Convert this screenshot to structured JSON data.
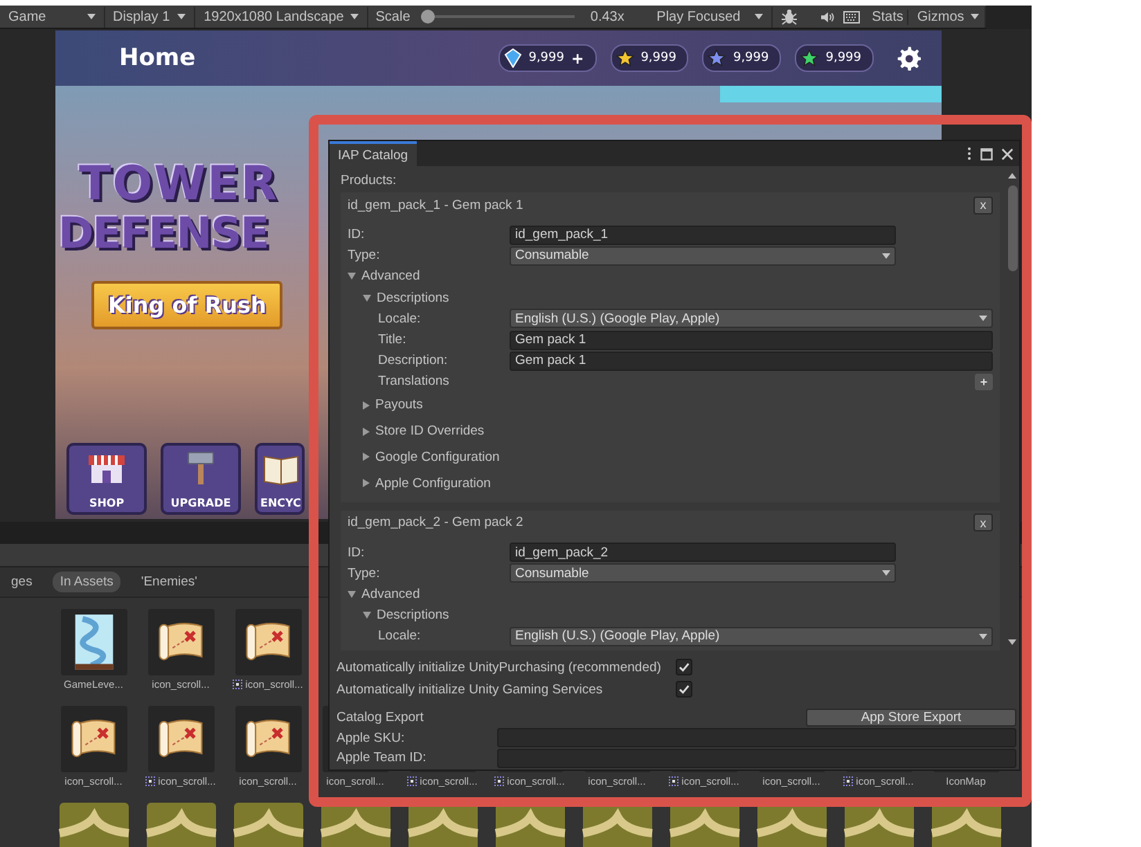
{
  "toolbar": {
    "view": "Game",
    "display": "Display 1",
    "resolution": "1920x1080 Landscape",
    "scale": {
      "label": "Scale",
      "level": 0,
      "reading": "0.43x"
    },
    "play_mode": "Play Focused",
    "stats": "Stats",
    "gizmos": "Gizmos"
  },
  "game_view": {
    "header_title": "Home",
    "currencies": [
      {
        "kind": "gem",
        "amount": "9,999",
        "add": "+"
      },
      {
        "kind": "star",
        "color": "#f2c531",
        "amount": "9,999"
      },
      {
        "kind": "star",
        "color": "#7d8ef0",
        "amount": "9,999"
      },
      {
        "kind": "star",
        "color": "#3fd16a",
        "amount": "9,999"
      }
    ],
    "title_lines": [
      "TOWER",
      "DEFENSE"
    ],
    "banner": "King of Rush",
    "menu_buttons": [
      {
        "kind": "shop",
        "label": "SHOP"
      },
      {
        "kind": "upgrade",
        "label": "UPGRADE"
      },
      {
        "kind": "book",
        "label": "ENCYC"
      }
    ]
  },
  "project": {
    "breadcrumbs": [
      {
        "label": "ges",
        "selected": false
      },
      {
        "label": "In Assets",
        "selected": true
      },
      {
        "label": "'Enemies'",
        "selected": false
      }
    ],
    "rows": [
      [
        {
          "kind": "level-map",
          "label": "GameLeve...",
          "sprite_sheet": false
        },
        {
          "kind": "scroll",
          "label": "icon_scroll...",
          "sprite_sheet": false
        },
        {
          "kind": "scroll",
          "label": "icon_scroll...",
          "sprite_sheet": true
        }
      ],
      [
        {
          "kind": "scroll",
          "label": "icon_scroll...",
          "sprite_sheet": false
        },
        {
          "kind": "scroll",
          "label": "icon_scroll...",
          "sprite_sheet": true
        },
        {
          "kind": "scroll",
          "label": "icon_scroll...",
          "sprite_sheet": false
        },
        {
          "kind": "scroll",
          "label": "icon_scroll...",
          "sprite_sheet": false
        },
        {
          "kind": "scroll",
          "label": "icon_scroll...",
          "sprite_sheet": true
        },
        {
          "kind": "scroll",
          "label": "icon_scroll...",
          "sprite_sheet": true
        },
        {
          "kind": "scroll",
          "label": "icon_scroll...",
          "sprite_sheet": false
        },
        {
          "kind": "scroll",
          "label": "icon_scroll...",
          "sprite_sheet": true
        },
        {
          "kind": "scroll",
          "label": "icon_scroll...",
          "sprite_sheet": false
        },
        {
          "kind": "scroll",
          "label": "icon_scroll...",
          "sprite_sheet": true
        },
        {
          "kind": "scroll",
          "label": "IconMap",
          "sprite_sheet": false
        }
      ],
      [
        {
          "kind": "terrain"
        },
        {
          "kind": "terrain"
        },
        {
          "kind": "terrain"
        },
        {
          "kind": "terrain"
        },
        {
          "kind": "terrain"
        },
        {
          "kind": "terrain"
        },
        {
          "kind": "terrain"
        },
        {
          "kind": "terrain"
        },
        {
          "kind": "terrain"
        },
        {
          "kind": "terrain"
        },
        {
          "kind": "terrain"
        }
      ]
    ]
  },
  "iap_catalog": {
    "tab": "IAP Catalog",
    "products_label": "Products:",
    "products": [
      {
        "header": "id_gem_pack_1 - Gem pack 1",
        "remove": "x",
        "rows": [
          {
            "kind": "text-field",
            "label": "ID:",
            "value": "id_gem_pack_1"
          },
          {
            "kind": "dropdown",
            "label": "Type:",
            "value": "Consumable"
          },
          {
            "kind": "foldout",
            "label": "Advanced",
            "expanded": true,
            "children": [
              {
                "kind": "foldout",
                "label": "Descriptions",
                "expanded": true,
                "children": [
                  {
                    "kind": "dropdown",
                    "label": "Locale:",
                    "value": "English (U.S.) (Google Play, Apple)"
                  },
                  {
                    "kind": "text-field",
                    "label": "Title:",
                    "value": "Gem pack 1"
                  },
                  {
                    "kind": "text-field",
                    "label": "Description:",
                    "value": "Gem pack 1"
                  },
                  {
                    "kind": "add-row",
                    "label": "Translations",
                    "button": "+"
                  }
                ]
              },
              {
                "kind": "foldout",
                "label": "Payouts",
                "expanded": false
              },
              {
                "kind": "foldout",
                "label": "Store ID Overrides",
                "expanded": false
              },
              {
                "kind": "foldout",
                "label": "Google Configuration",
                "expanded": false
              },
              {
                "kind": "foldout",
                "label": "Apple Configuration",
                "expanded": false
              }
            ]
          }
        ]
      },
      {
        "header": "id_gem_pack_2 - Gem pack 2",
        "remove": "x",
        "rows": [
          {
            "kind": "text-field",
            "label": "ID:",
            "value": "id_gem_pack_2"
          },
          {
            "kind": "dropdown",
            "label": "Type:",
            "value": "Consumable"
          },
          {
            "kind": "foldout",
            "label": "Advanced",
            "expanded": true,
            "children": [
              {
                "kind": "foldout",
                "label": "Descriptions",
                "expanded": true,
                "children": [
                  {
                    "kind": "dropdown",
                    "label": "Locale:",
                    "value": "English (U.S.) (Google Play, Apple)"
                  }
                ]
              }
            ]
          }
        ]
      }
    ],
    "options": [
      {
        "label": "Automatically initialize UnityPurchasing (recommended)",
        "checked": true
      },
      {
        "label": "Automatically initialize Unity Gaming Services",
        "checked": true
      }
    ],
    "export": {
      "label": "Catalog Export",
      "button": "App Store Export"
    },
    "fields": [
      {
        "label": "Apple SKU:"
      },
      {
        "label": "Apple Team ID:"
      }
    ]
  }
}
